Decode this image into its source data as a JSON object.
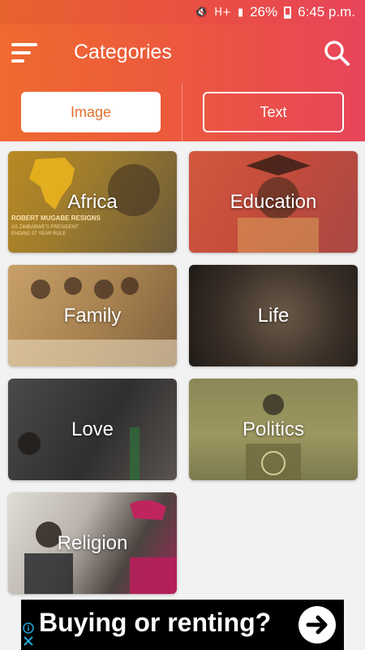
{
  "status_bar": {
    "battery": "26%",
    "time": "6:45 p.m.",
    "network": "H+"
  },
  "app_bar": {
    "title": "Categories",
    "menu_icon": "menu-icon",
    "search_icon": "search-icon"
  },
  "tabs": [
    {
      "label": "Image",
      "selected": true
    },
    {
      "label": "Text",
      "selected": false
    }
  ],
  "categories": [
    {
      "label": "Africa"
    },
    {
      "label": "Education"
    },
    {
      "label": "Family"
    },
    {
      "label": "Life"
    },
    {
      "label": "Love"
    },
    {
      "label": "Politics"
    },
    {
      "label": "Religion"
    }
  ],
  "card_captions": {
    "africa_headline": "ROBERT MUGABE RESIGNS",
    "africa_sub1": "AS ZIMBABWE'S PRESIDENT",
    "africa_sub2": "ENDING 37 YEAR RULE"
  },
  "ad": {
    "text": "Buying or renting?",
    "info_icon": "info-icon",
    "close_icon": "close-icon",
    "arrow_icon": "arrow-right-icon"
  },
  "colors": {
    "accent": "#ec5a3c",
    "tab_text_selected": "#e2702e"
  }
}
